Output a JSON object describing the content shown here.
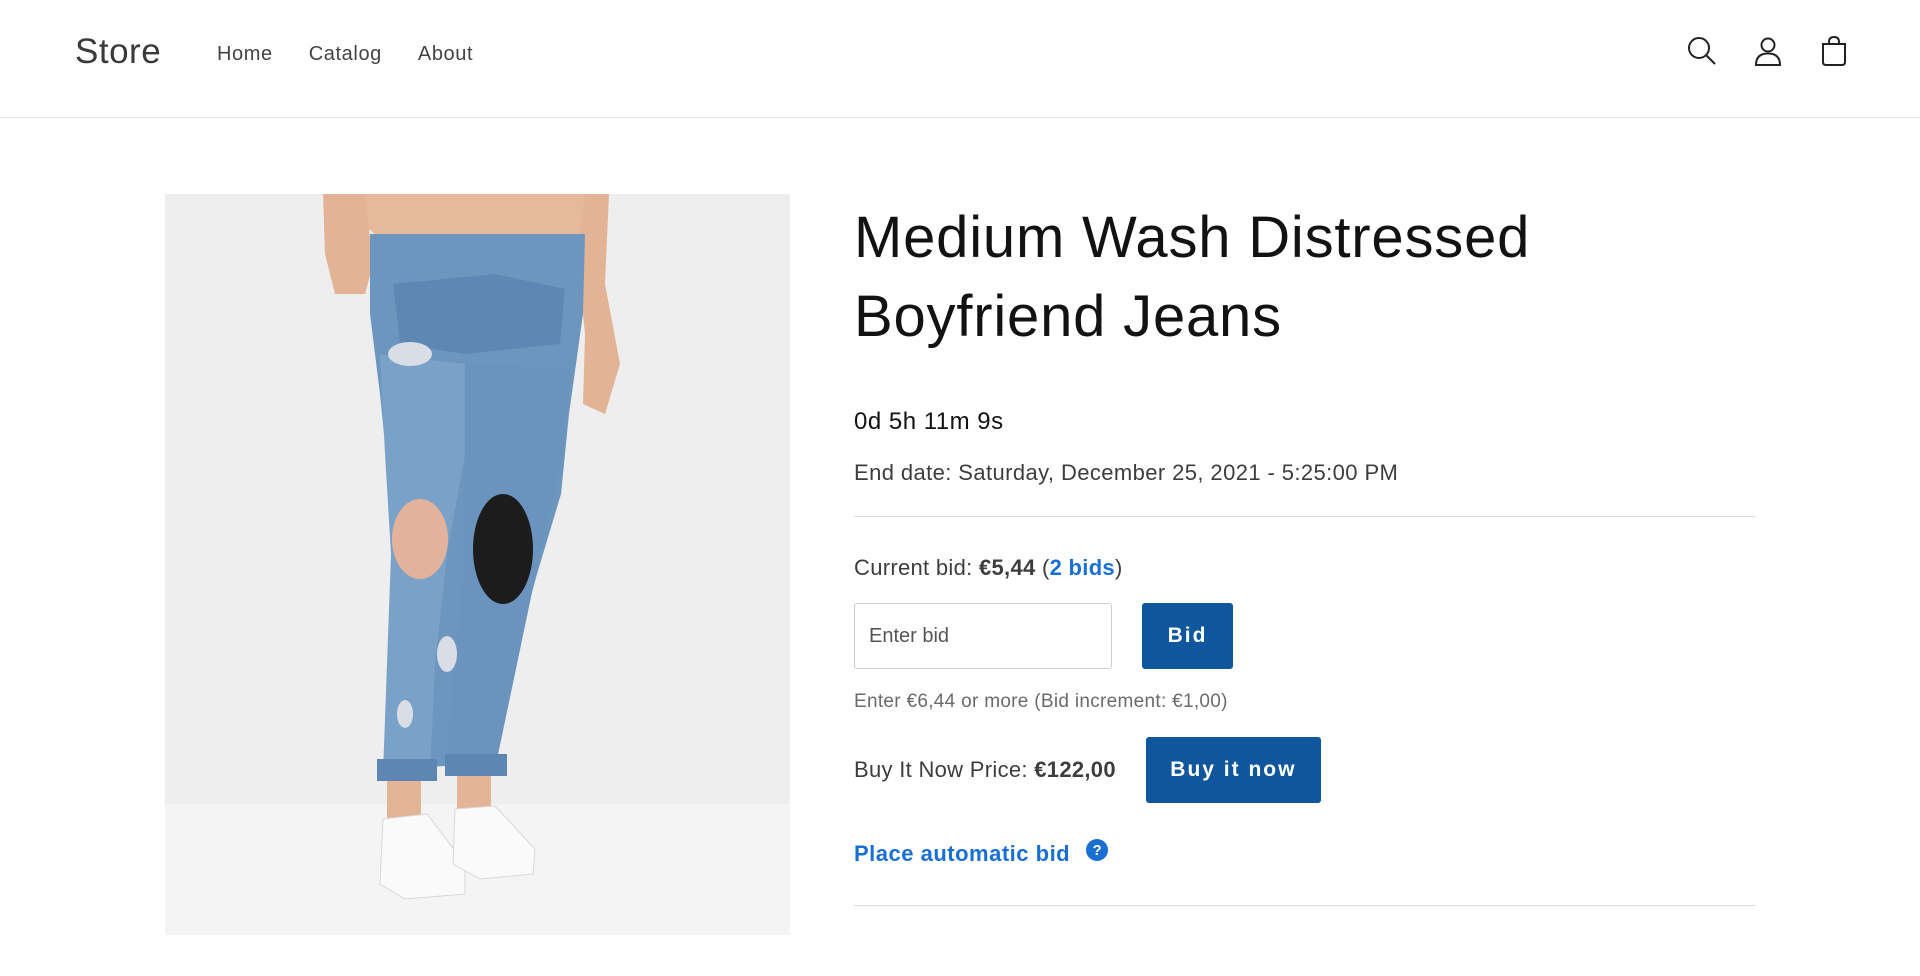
{
  "header": {
    "logo": "Store",
    "nav": [
      {
        "label": "Home"
      },
      {
        "label": "Catalog"
      },
      {
        "label": "About"
      }
    ],
    "icons": [
      "search-icon",
      "account-icon",
      "cart-icon"
    ]
  },
  "product": {
    "image_alt": "Medium Wash Distressed Boyfriend Jeans",
    "title": "Medium Wash Distressed Boyfriend Jeans",
    "countdown": "0d 5h 11m 9s",
    "end_date": "End date: Saturday, December 25, 2021 - 5:25:00 PM",
    "current_bid": {
      "label": "Current bid:",
      "amount": "€5,44",
      "open_paren": "(",
      "bids_link": "2 bids",
      "close_paren": ")"
    },
    "bid_input": {
      "placeholder": "Enter bid",
      "value": ""
    },
    "bid_button": "Bid",
    "hint": "Enter €6,44 or more (Bid increment: €1,00)",
    "buy_now": {
      "label": "Buy It Now Price:",
      "price": "€122,00",
      "button": "Buy it now"
    },
    "auto_bid": {
      "link": "Place automatic bid",
      "help": "?"
    }
  },
  "colors": {
    "primary_button": "#0f569c",
    "link": "#1a6fd4",
    "text": "#121212",
    "muted": "#6b6b6b"
  }
}
